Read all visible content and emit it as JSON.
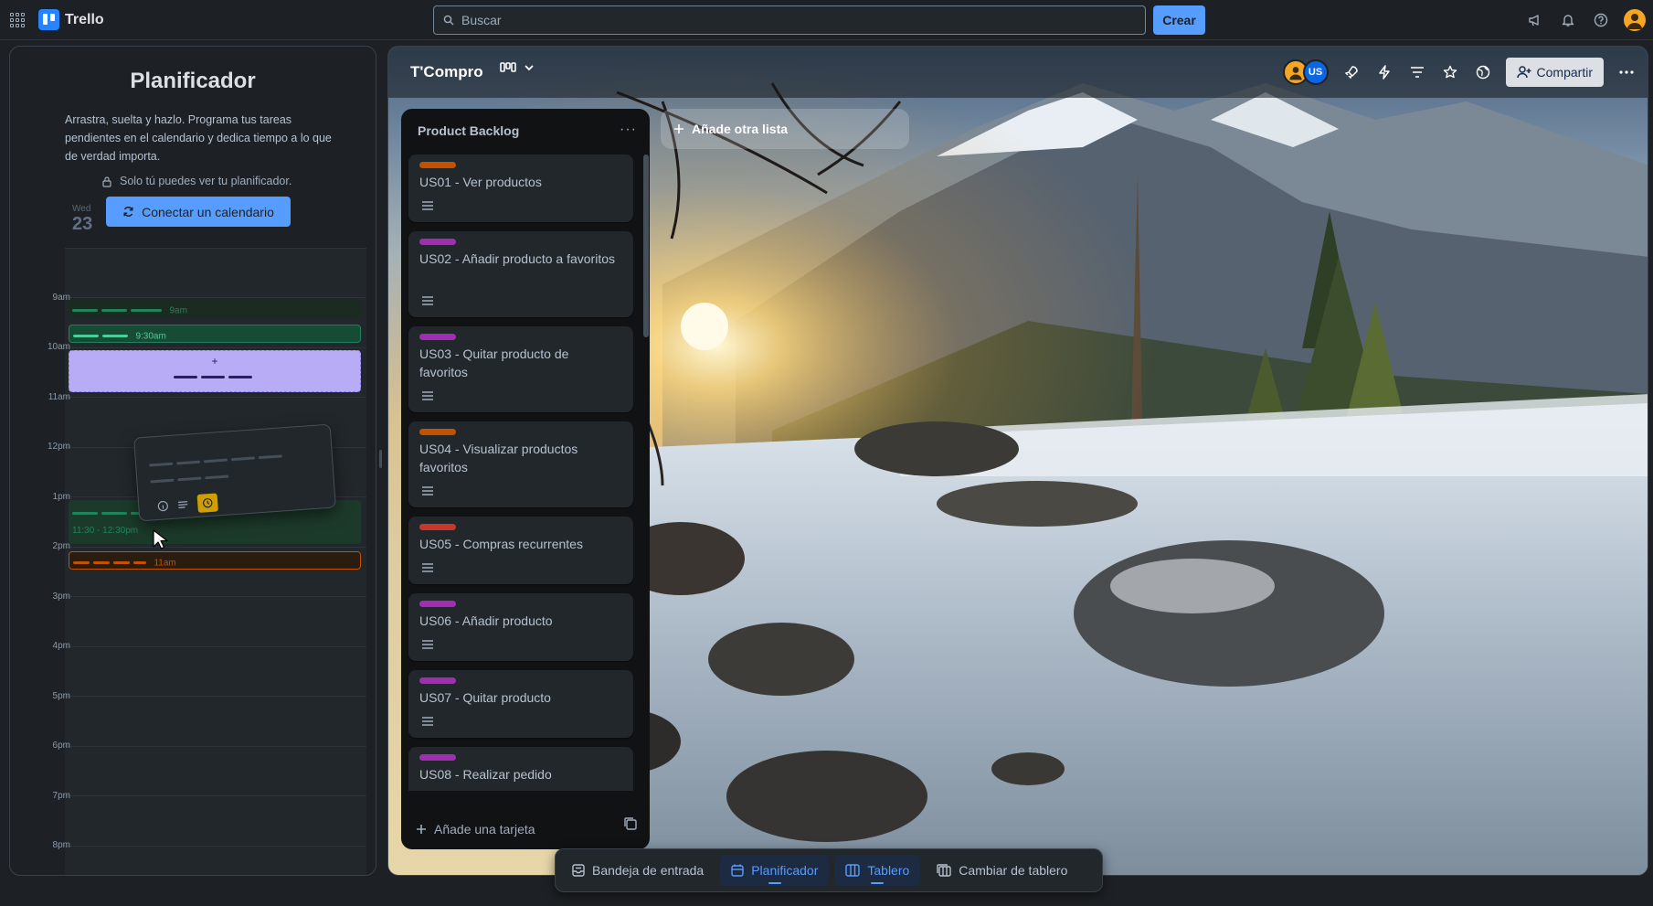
{
  "app": {
    "name": "Trello",
    "search_placeholder": "Buscar",
    "create_label": "Crear"
  },
  "planner": {
    "title": "Planificador",
    "description": "Arrastra, suelta y hazlo. Programa tus tareas pendientes en el calendario y dedica tiempo a lo que de verdad importa.",
    "private_note": "Solo tú puedes ver tu planificador.",
    "connect_label": "Conectar un calendario",
    "weekday": "Wed",
    "day_number": "23",
    "hours": [
      "9am",
      "10am",
      "11am",
      "12pm",
      "1pm",
      "2pm",
      "3pm",
      "4pm",
      "5pm",
      "6pm",
      "7pm",
      "8pm"
    ],
    "events": {
      "ev1_time": "9am",
      "ev2_time": "9:30am",
      "ev3_time": "11:30 - 12:30pm",
      "ev4_time": "11am"
    },
    "add_symbol": "+"
  },
  "board": {
    "title": "T'Compro",
    "share_label": "Compartir",
    "member_initials": "US",
    "add_list_label": "Añade otra lista",
    "list": {
      "title": "Product Backlog",
      "add_card_label": "Añade una tarjeta",
      "cards": [
        {
          "label_color": "#c25100",
          "title": "US01 - Ver productos"
        },
        {
          "label_color": "#9f2eb3",
          "title": "US02 - Añadir producto a favoritos"
        },
        {
          "label_color": "#9f2eb3",
          "title": "US03 - Quitar producto de favoritos"
        },
        {
          "label_color": "#c25100",
          "title": "US04 - Visualizar productos favoritos"
        },
        {
          "label_color": "#c9372c",
          "title": "US05 - Compras recurrentes"
        },
        {
          "label_color": "#9f2eb3",
          "title": "US06 - Añadir producto"
        },
        {
          "label_color": "#9f2eb3",
          "title": "US07 - Quitar producto"
        },
        {
          "label_color": "#9f2eb3",
          "title": "US08 - Realizar pedido"
        }
      ]
    }
  },
  "switcher": {
    "inbox": "Bandeja de entrada",
    "planner": "Planificador",
    "board": "Tablero",
    "change": "Cambiar de tablero"
  },
  "colors": {
    "accent": "#579dff",
    "background": "#1d2125",
    "green_event": "#1f845a",
    "orange_event": "#c25100",
    "drop_zone": "#b8acf6"
  },
  "icons": [
    "apps-grid-icon",
    "trello-logo",
    "search-icon",
    "megaphone-icon",
    "bell-icon",
    "help-icon",
    "lock-icon",
    "sync-icon",
    "table-view-icon",
    "chevron-down-icon",
    "rocket-icon",
    "lightning-icon",
    "filter-icon",
    "star-icon",
    "globe-icon",
    "add-member-icon",
    "more-icon",
    "plus-icon",
    "template-icon",
    "inbox-icon",
    "calendar-icon",
    "board-icon",
    "switch-board-icon"
  ]
}
